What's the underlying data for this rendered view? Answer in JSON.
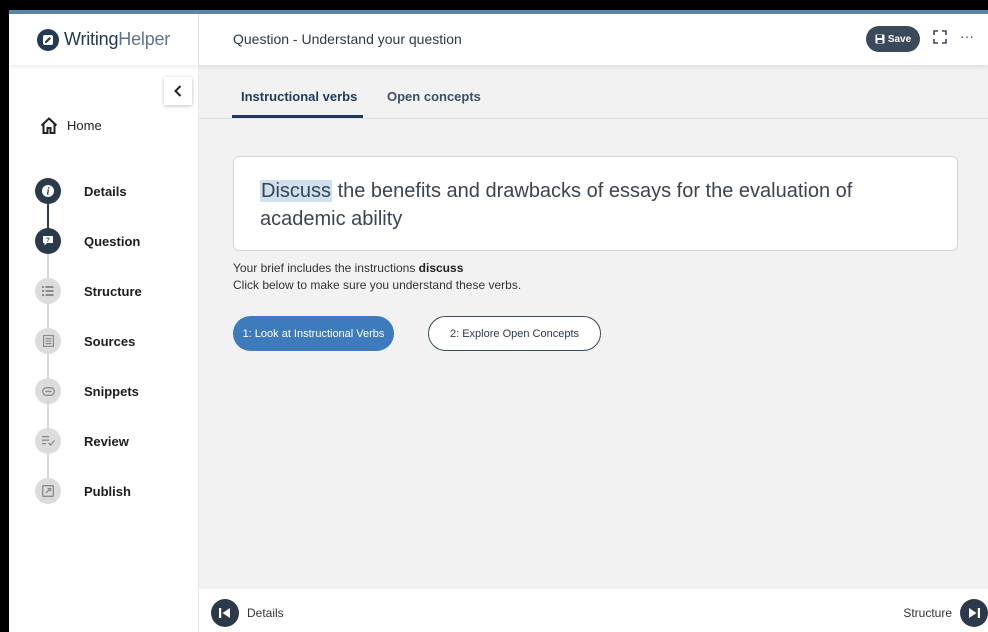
{
  "app": {
    "brand_part1": "Writing",
    "brand_part2": "Helper",
    "page_title": "Question - Understand your question",
    "save_label": "Save"
  },
  "sidebar": {
    "home_label": "Home",
    "steps": [
      {
        "label": "Details",
        "icon": "info-icon",
        "state": "done"
      },
      {
        "label": "Question",
        "icon": "question-bubble-icon",
        "state": "active"
      },
      {
        "label": "Structure",
        "icon": "list-icon",
        "state": "todo"
      },
      {
        "label": "Sources",
        "icon": "document-icon",
        "state": "todo"
      },
      {
        "label": "Snippets",
        "icon": "clip-icon",
        "state": "todo"
      },
      {
        "label": "Review",
        "icon": "checklist-icon",
        "state": "todo"
      },
      {
        "label": "Publish",
        "icon": "external-link-icon",
        "state": "todo"
      }
    ]
  },
  "tabs": [
    {
      "label": "Instructional verbs",
      "active": true
    },
    {
      "label": "Open concepts",
      "active": false
    }
  ],
  "question": {
    "highlight": "Discuss",
    "rest": " the benefits and drawbacks of essays for the evaluation of academic ability"
  },
  "brief": {
    "line1_prefix": "Your brief includes the instructions ",
    "line1_verb": "discuss",
    "line2": "Click below to make sure you understand these verbs."
  },
  "buttons": {
    "primary": "1: Look at Instructional Verbs",
    "secondary": "2: Explore Open Concepts"
  },
  "footer": {
    "prev_label": "Details",
    "next_label": "Structure"
  },
  "colors": {
    "primary": "#3d7bbd",
    "dark": "#2b3a4a",
    "accent_top": "#5b86a8"
  }
}
